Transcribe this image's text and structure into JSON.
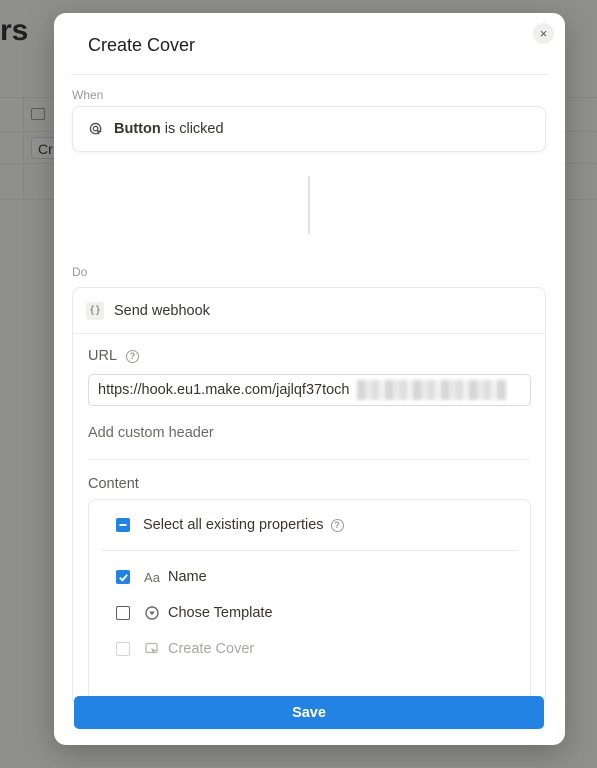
{
  "background": {
    "title_fragment": "rs",
    "chip_fragment": "Cr"
  },
  "modal": {
    "title": "Create Cover",
    "close_label": "×"
  },
  "when": {
    "label": "When",
    "trigger_bold": "Button",
    "trigger_rest": " is clicked"
  },
  "do": {
    "label": "Do",
    "action_icon_text": "{}",
    "action_title": "Send webhook",
    "url_label": "URL",
    "url_value": "https://hook.eu1.make.com/jajlqf37toch",
    "add_header": "Add custom header",
    "content_label": "Content",
    "select_all_label": "Select all existing properties",
    "properties": [
      {
        "icon": "Aa",
        "label": "Name",
        "state": "checked"
      },
      {
        "icon": "chevron-circle-icon",
        "label": "Chose Template",
        "state": "unchecked"
      },
      {
        "icon": "cursor-box-icon",
        "label": "Create Cover",
        "state": "disabled"
      }
    ]
  },
  "footer": {
    "save_label": "Save"
  },
  "colors": {
    "accent": "#2383e2",
    "overlay": "#8a8a88"
  }
}
